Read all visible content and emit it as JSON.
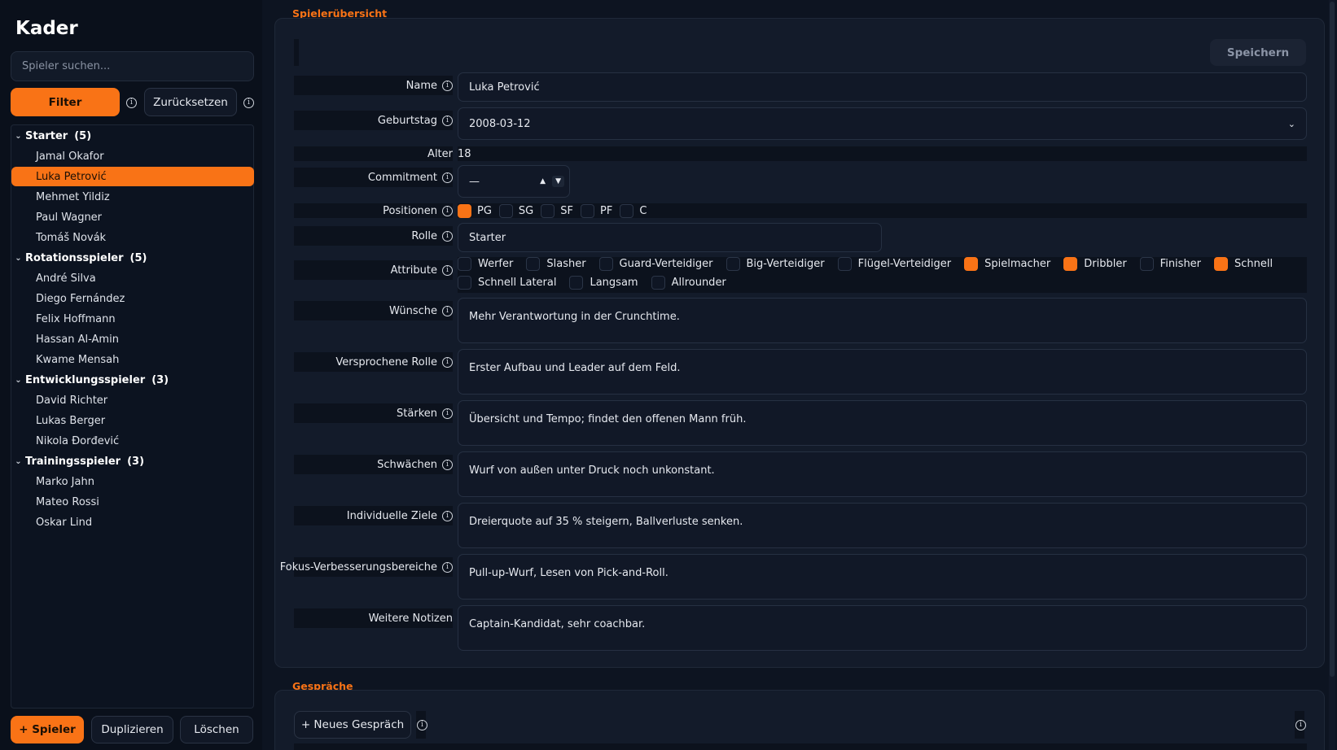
{
  "sidebar": {
    "title": "Kader",
    "search_placeholder": "Spieler suchen...",
    "filter_label": "Filter",
    "reset_label": "Zurücksetzen",
    "groups": [
      {
        "name": "Starter",
        "count": "(5)",
        "players": [
          "Jamal Okafor",
          "Luka Petrović",
          "Mehmet Yildiz",
          "Paul Wagner",
          "Tomáš Novák"
        ]
      },
      {
        "name": "Rotationsspieler",
        "count": "(5)",
        "players": [
          "André Silva",
          "Diego Fernández",
          "Felix Hoffmann",
          "Hassan Al-Amin",
          "Kwame Mensah"
        ]
      },
      {
        "name": "Entwicklungsspieler",
        "count": "(3)",
        "players": [
          "David Richter",
          "Lukas Berger",
          "Nikola Đorđević"
        ]
      },
      {
        "name": "Trainingsspieler",
        "count": "(3)",
        "players": [
          "Marko Jahn",
          "Mateo Rossi",
          "Oskar Lind"
        ]
      }
    ],
    "selected_player": "Luka Petrović",
    "add_label": "+ Spieler",
    "duplicate_label": "Duplizieren",
    "delete_label": "Löschen"
  },
  "overview": {
    "section_title": "Spielerübersicht",
    "save_label": "Speichern",
    "name_label": "Name",
    "name_value": "Luka Petrović",
    "birthday_label": "Geburtstag",
    "birthday_value": "2008-03-12",
    "age_label": "Alter",
    "age_value": "18",
    "commitment_label": "Commitment",
    "commitment_value": "—",
    "positions_label": "Positionen",
    "positions": [
      {
        "label": "PG",
        "checked": true
      },
      {
        "label": "SG",
        "checked": false
      },
      {
        "label": "SF",
        "checked": false
      },
      {
        "label": "PF",
        "checked": false
      },
      {
        "label": "C",
        "checked": false
      }
    ],
    "role_label": "Rolle",
    "role_value": "Starter",
    "attributes_label": "Attribute",
    "attributes": [
      {
        "label": "Werfer",
        "checked": false
      },
      {
        "label": "Slasher",
        "checked": false
      },
      {
        "label": "Guard-Verteidiger",
        "checked": false
      },
      {
        "label": "Big-Verteidiger",
        "checked": false
      },
      {
        "label": "Flügel-Verteidiger",
        "checked": false
      },
      {
        "label": "Spielmacher",
        "checked": true
      },
      {
        "label": "Dribbler",
        "checked": true
      },
      {
        "label": "Finisher",
        "checked": false
      },
      {
        "label": "Schnell",
        "checked": true
      },
      {
        "label": "Schnell Lateral",
        "checked": false
      },
      {
        "label": "Langsam",
        "checked": false
      },
      {
        "label": "Allrounder",
        "checked": false
      }
    ],
    "text_fields": [
      {
        "label": "Wünsche",
        "value": "Mehr Verantwortung in der Crunchtime.",
        "info": true
      },
      {
        "label": "Versprochene Rolle",
        "value": "Erster Aufbau und Leader auf dem Feld.",
        "info": true
      },
      {
        "label": "Stärken",
        "value": "Übersicht und Tempo; findet den offenen Mann früh.",
        "info": true
      },
      {
        "label": "Schwächen",
        "value": "Wurf von außen unter Druck noch unkonstant.",
        "info": true
      },
      {
        "label": "Individuelle Ziele",
        "value": "Dreierquote auf 35 % steigern, Ballverluste senken.",
        "info": true
      },
      {
        "label": "Fokus-Verbesserungsbereiche",
        "value": "Pull-up-Wurf, Lesen von Pick-and-Roll.",
        "info": true
      },
      {
        "label": "Weitere Notizen",
        "value": "Captain-Kandidat, sehr coachbar.",
        "info": false
      }
    ]
  },
  "conversations": {
    "section_title": "Gespräche",
    "new_label": "+ Neues Gespräch"
  },
  "colors": {
    "accent": "#f97316",
    "background": "#0d1421",
    "panel": "#131b2a"
  }
}
